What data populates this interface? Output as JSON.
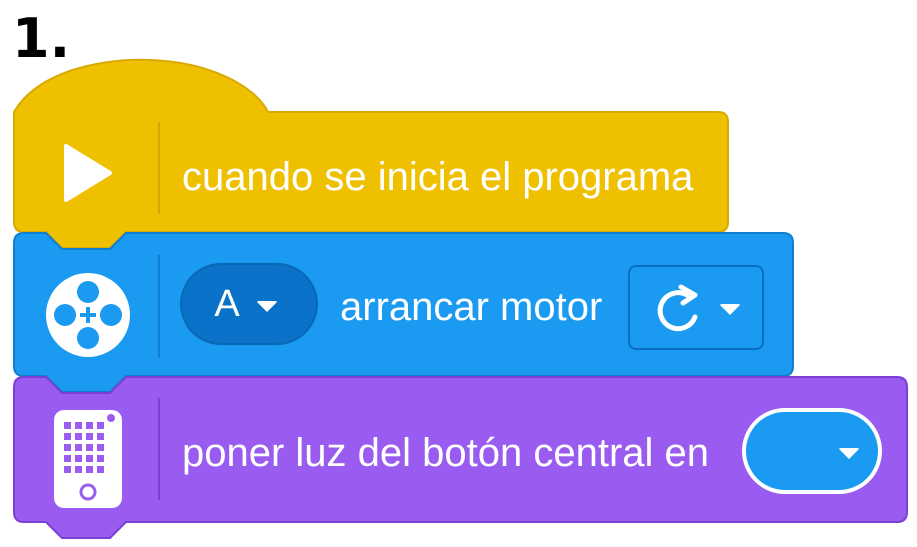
{
  "step": {
    "number": "1."
  },
  "colors": {
    "events_block": "#efc000",
    "motors_block": "#1a9af0",
    "light_block": "#9a5cf0",
    "port_pill": "#0a72c8",
    "white": "#ffffff"
  },
  "blocks": [
    {
      "category": "events",
      "icon": "play-icon",
      "label": "cuando se inicia el programa"
    },
    {
      "category": "motors",
      "icon": "motor-icon",
      "port": {
        "value": "A"
      },
      "label": "arrancar motor",
      "direction": {
        "icon": "rotate-clockwise-icon"
      }
    },
    {
      "category": "light",
      "icon": "hub-light-matrix-icon",
      "label": "poner luz del botón central en",
      "color": {
        "value": "#1a9af0"
      }
    }
  ]
}
